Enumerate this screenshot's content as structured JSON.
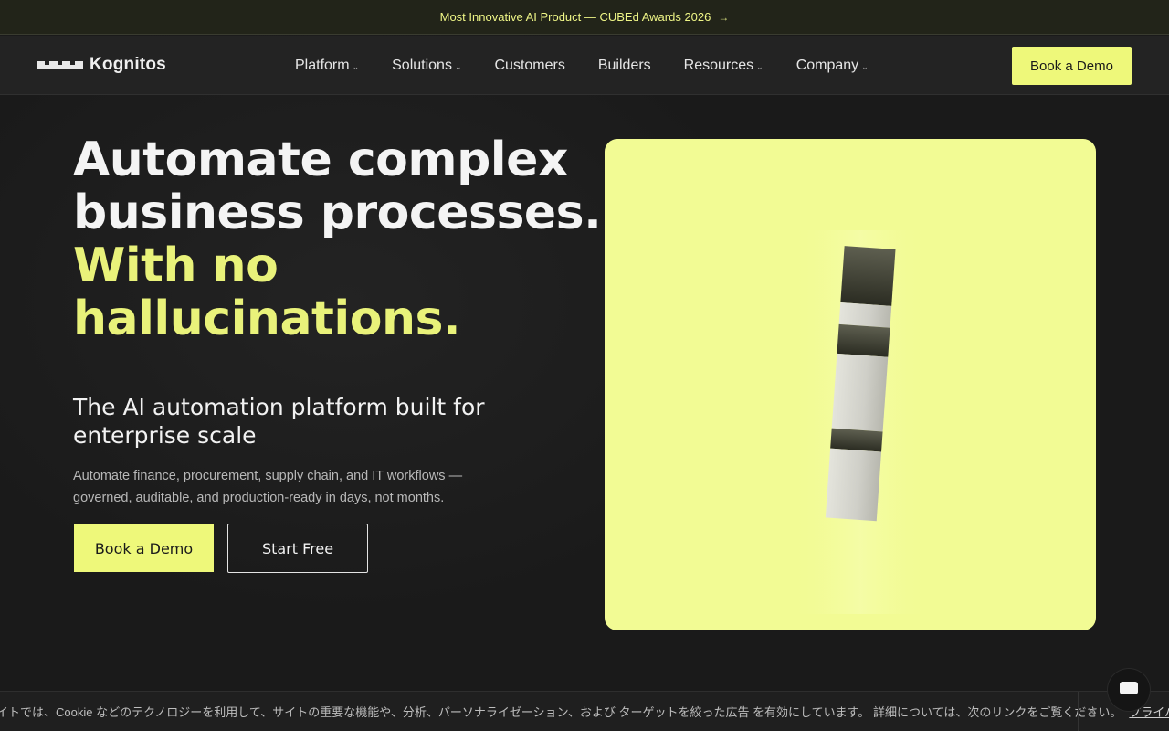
{
  "announcement": {
    "text": "Most Innovative AI Product — CUBEd Awards 2026",
    "arrow_icon": "arrow-right-icon"
  },
  "nav": {
    "logo_text": "Kognitos",
    "items": [
      {
        "label": "Platform",
        "has_dropdown": true
      },
      {
        "label": "Solutions",
        "has_dropdown": true
      },
      {
        "label": "Customers",
        "has_dropdown": false
      },
      {
        "label": "Builders",
        "has_dropdown": false
      },
      {
        "label": "Resources",
        "has_dropdown": true
      },
      {
        "label": "Company",
        "has_dropdown": true
      }
    ],
    "cta_label": "Book a Demo"
  },
  "hero": {
    "headline_line1": "Automate complex",
    "headline_line2": "business processes.",
    "accent_line1": "With no",
    "accent_line2": "hallucinations.",
    "subhead": "The AI automation platform built for enterprise scale",
    "description": "Automate finance, procurement, supply chain, and IT workflows — governed, auditable, and production-ready in days, not months.",
    "primary_cta": "Book a Demo",
    "secondary_cta": "Start Free"
  },
  "cookie_banner": {
    "text": "イトでは、Cookie などのテクノロジーを利用して、サイトの重要な機能や、分析、パーソナライゼーション、および ターゲットを絞った広告 を有効にしています。 詳細については、次のリンクをご覧ください。",
    "link": "プライバ"
  },
  "colors": {
    "accent": "#eef87a",
    "background": "#1a1a1a",
    "card": "#f2fb94"
  }
}
